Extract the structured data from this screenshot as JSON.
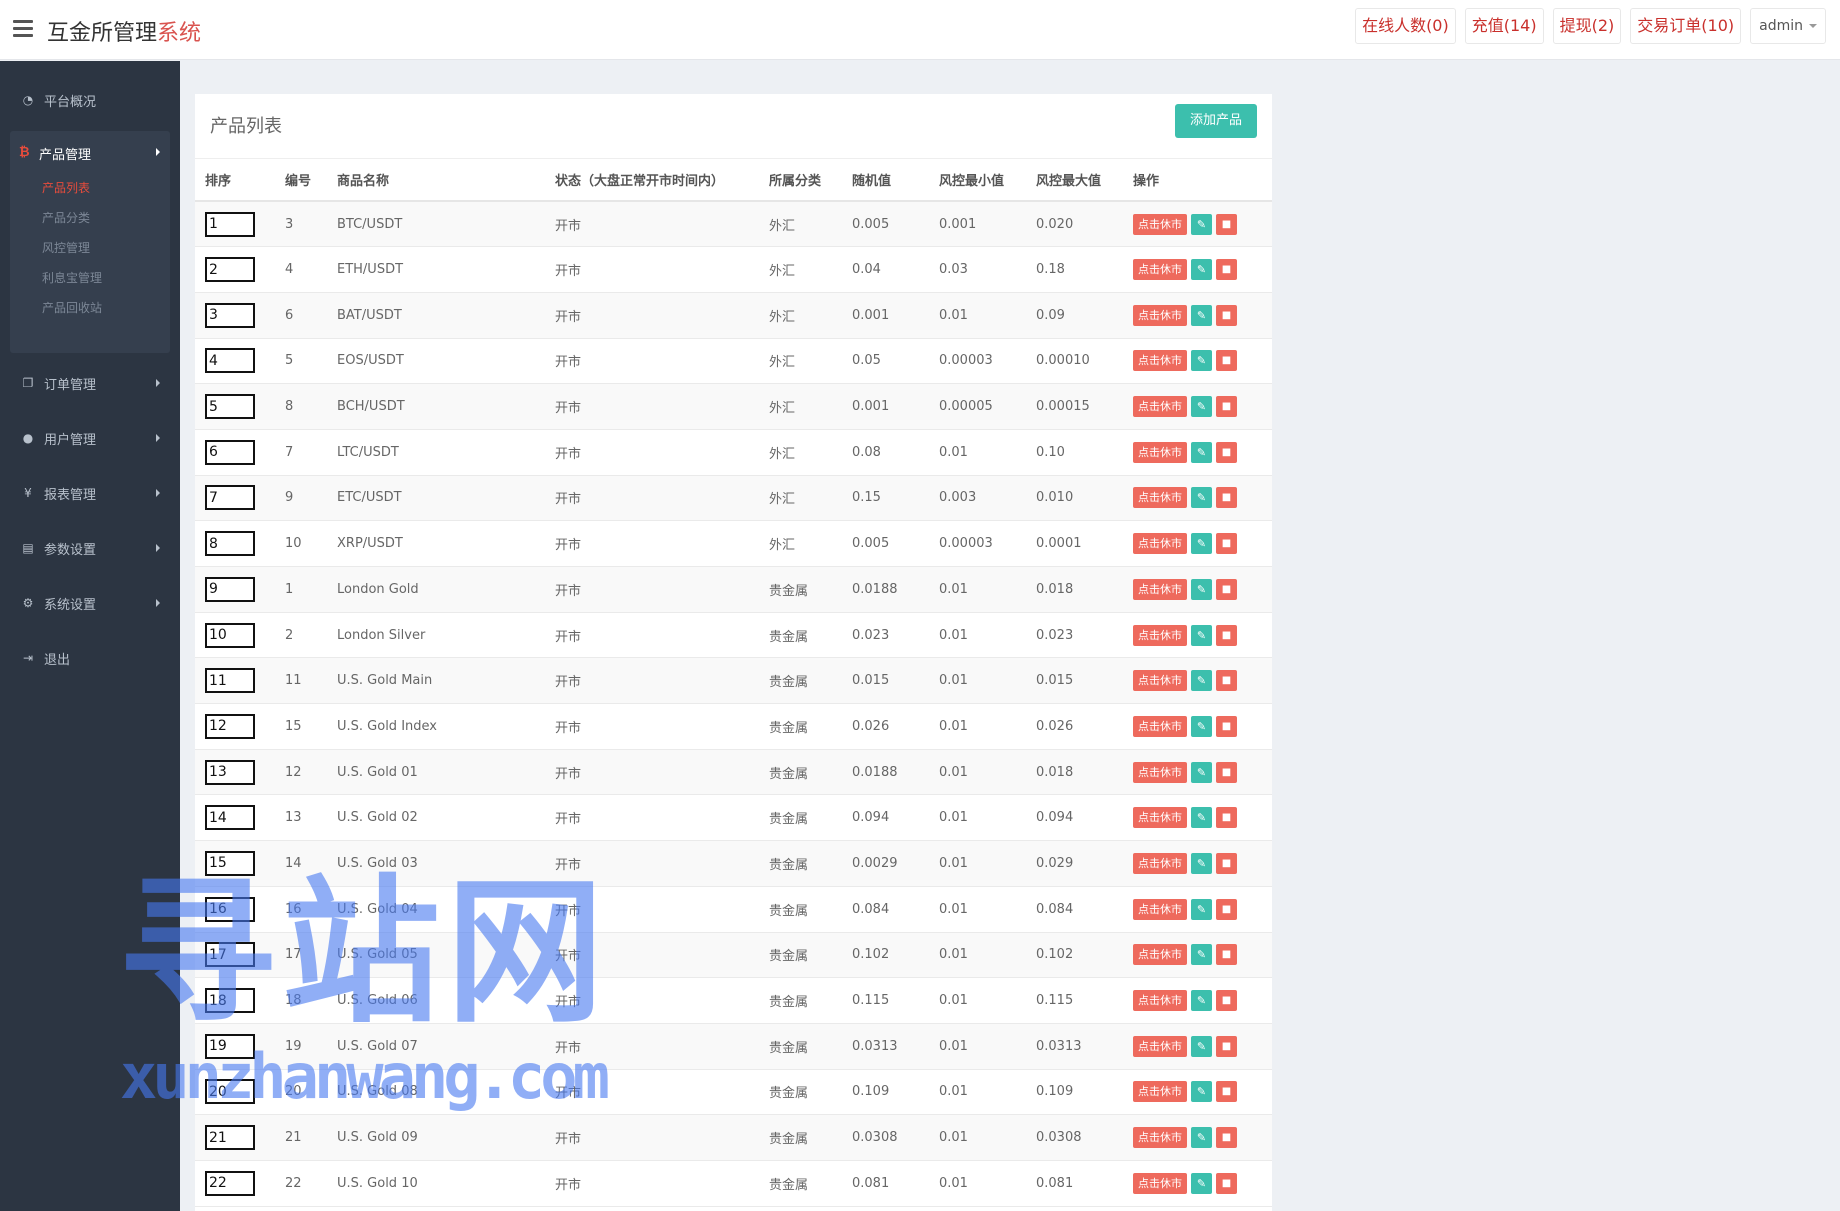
{
  "app": {
    "title_main": "互金所管理",
    "title_accent": "系统"
  },
  "topbar": {
    "online": "在线人数(0)",
    "recharge": "充值(14)",
    "withdraw": "提现(2)",
    "orders": "交易订单(10)",
    "user": "admin"
  },
  "sidebar": {
    "overview": "平台概况",
    "product_mgmt": "产品管理",
    "product_sub": [
      "产品列表",
      "产品分类",
      "风控管理",
      "利息宝管理",
      "产品回收站"
    ],
    "order_mgmt": "订单管理",
    "user_mgmt": "用户管理",
    "report_mgmt": "报表管理",
    "params": "参数设置",
    "system": "系统设置",
    "logout": "退出"
  },
  "panel": {
    "title": "产品列表",
    "add_button": "添加产品",
    "headers": [
      "排序",
      "编号",
      "商品名称",
      "状态（大盘正常开市时间内）",
      "所属分类",
      "随机值",
      "风控最小值",
      "风控最大值",
      "操作"
    ],
    "close_label": "点击休市",
    "rows": [
      {
        "sort": "1",
        "id": "3",
        "name": "BTC/USDT",
        "status": "开市",
        "category": "外汇",
        "random": "0.005",
        "min": "0.001",
        "max": "0.020"
      },
      {
        "sort": "2",
        "id": "4",
        "name": "ETH/USDT",
        "status": "开市",
        "category": "外汇",
        "random": "0.04",
        "min": "0.03",
        "max": "0.18"
      },
      {
        "sort": "3",
        "id": "6",
        "name": "BAT/USDT",
        "status": "开市",
        "category": "外汇",
        "random": "0.001",
        "min": "0.01",
        "max": "0.09"
      },
      {
        "sort": "4",
        "id": "5",
        "name": "EOS/USDT",
        "status": "开市",
        "category": "外汇",
        "random": "0.05",
        "min": "0.00003",
        "max": "0.00010"
      },
      {
        "sort": "5",
        "id": "8",
        "name": "BCH/USDT",
        "status": "开市",
        "category": "外汇",
        "random": "0.001",
        "min": "0.00005",
        "max": "0.00015"
      },
      {
        "sort": "6",
        "id": "7",
        "name": "LTC/USDT",
        "status": "开市",
        "category": "外汇",
        "random": "0.08",
        "min": "0.01",
        "max": "0.10"
      },
      {
        "sort": "7",
        "id": "9",
        "name": "ETC/USDT",
        "status": "开市",
        "category": "外汇",
        "random": "0.15",
        "min": "0.003",
        "max": "0.010"
      },
      {
        "sort": "8",
        "id": "10",
        "name": "XRP/USDT",
        "status": "开市",
        "category": "外汇",
        "random": "0.005",
        "min": "0.00003",
        "max": "0.0001"
      },
      {
        "sort": "9",
        "id": "1",
        "name": "London Gold",
        "status": "开市",
        "category": "贵金属",
        "random": "0.0188",
        "min": "0.01",
        "max": "0.018"
      },
      {
        "sort": "10",
        "id": "2",
        "name": "London Silver",
        "status": "开市",
        "category": "贵金属",
        "random": "0.023",
        "min": "0.01",
        "max": "0.023"
      },
      {
        "sort": "11",
        "id": "11",
        "name": "U.S. Gold Main",
        "status": "开市",
        "category": "贵金属",
        "random": "0.015",
        "min": "0.01",
        "max": "0.015"
      },
      {
        "sort": "12",
        "id": "15",
        "name": "U.S. Gold Index",
        "status": "开市",
        "category": "贵金属",
        "random": "0.026",
        "min": "0.01",
        "max": "0.026"
      },
      {
        "sort": "13",
        "id": "12",
        "name": "U.S. Gold 01",
        "status": "开市",
        "category": "贵金属",
        "random": "0.0188",
        "min": "0.01",
        "max": "0.018"
      },
      {
        "sort": "14",
        "id": "13",
        "name": "U.S. Gold 02",
        "status": "开市",
        "category": "贵金属",
        "random": "0.094",
        "min": "0.01",
        "max": "0.094"
      },
      {
        "sort": "15",
        "id": "14",
        "name": "U.S. Gold 03",
        "status": "开市",
        "category": "贵金属",
        "random": "0.0029",
        "min": "0.01",
        "max": "0.029"
      },
      {
        "sort": "16",
        "id": "16",
        "name": "U.S. Gold 04",
        "status": "开市",
        "category": "贵金属",
        "random": "0.084",
        "min": "0.01",
        "max": "0.084"
      },
      {
        "sort": "17",
        "id": "17",
        "name": "U.S. Gold 05",
        "status": "开市",
        "category": "贵金属",
        "random": "0.102",
        "min": "0.01",
        "max": "0.102"
      },
      {
        "sort": "18",
        "id": "18",
        "name": "U.S. Gold 06",
        "status": "开市",
        "category": "贵金属",
        "random": "0.115",
        "min": "0.01",
        "max": "0.115"
      },
      {
        "sort": "19",
        "id": "19",
        "name": "U.S. Gold 07",
        "status": "开市",
        "category": "贵金属",
        "random": "0.0313",
        "min": "0.01",
        "max": "0.0313"
      },
      {
        "sort": "20",
        "id": "20",
        "name": "U.S. Gold 08",
        "status": "开市",
        "category": "贵金属",
        "random": "0.109",
        "min": "0.01",
        "max": "0.109"
      },
      {
        "sort": "21",
        "id": "21",
        "name": "U.S. Gold 09",
        "status": "开市",
        "category": "贵金属",
        "random": "0.0308",
        "min": "0.01",
        "max": "0.0308"
      },
      {
        "sort": "22",
        "id": "22",
        "name": "U.S. Gold 10",
        "status": "开市",
        "category": "贵金属",
        "random": "0.081",
        "min": "0.01",
        "max": "0.081"
      }
    ]
  },
  "watermark": {
    "main": "寻站网",
    "sub": "xunzhanwang.com"
  },
  "colors": {
    "sidebar_bg": "#2c3542",
    "accent_red": "#e74c3c",
    "teal": "#3cbfad",
    "btn_red": "#ee6a5d"
  },
  "icons": {
    "menu": "hamburger-icon",
    "overview": "dashboard-icon",
    "product": "bitcoin-icon",
    "order": "copy-icon",
    "user": "user-icon",
    "report": "yen-icon",
    "params": "file-icon",
    "system": "gears-icon",
    "logout": "sign-out-icon",
    "edit": "pencil-icon",
    "delete": "trash-icon"
  }
}
